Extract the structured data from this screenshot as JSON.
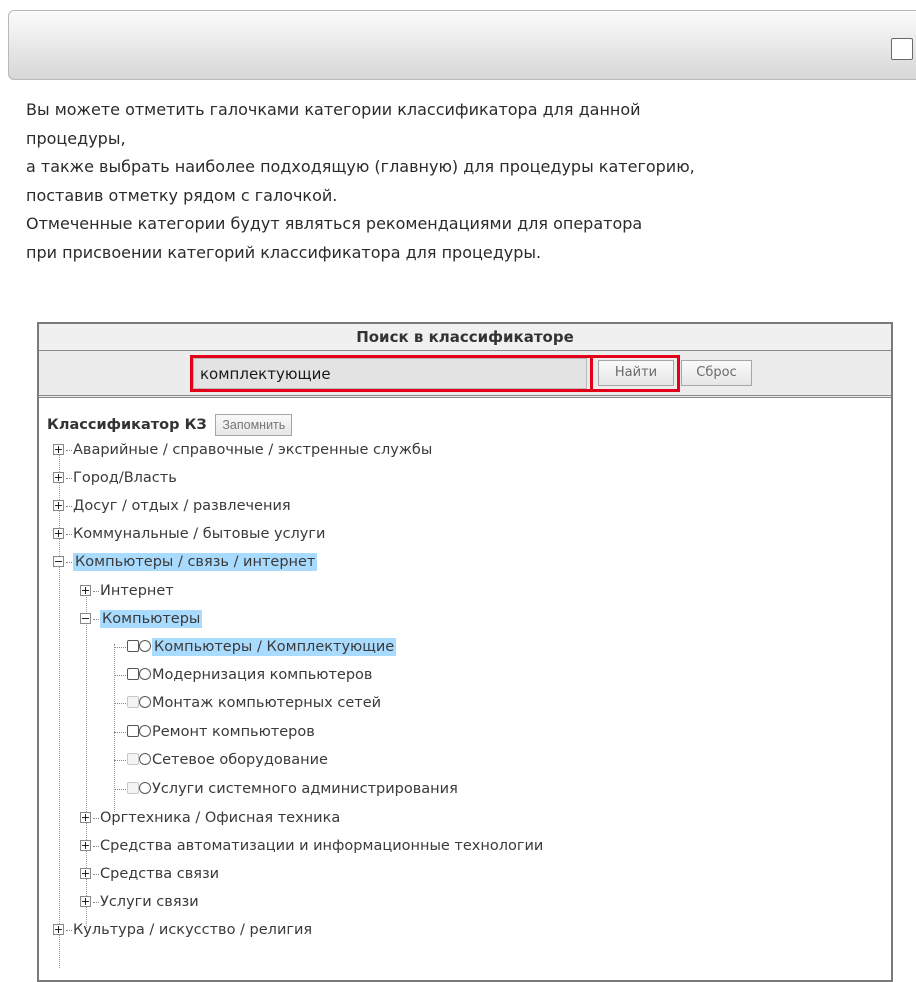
{
  "intro": {
    "line1": "Вы можете отметить галочками категории классификатора для данной",
    "line2": "процедуры,",
    "line3": "а также выбрать наиболее подходящую (главную) для процедуры категорию,",
    "line4": "поставив отметку рядом с галочкой.",
    "line5": "Отмеченные категории будут являться рекомендациями для оператора",
    "line6": "при присвоении категорий классификатора для процедуры."
  },
  "search": {
    "title": "Поиск в классификаторе",
    "value": "комплектующие",
    "find_label": "Найти",
    "reset_label": "Сброс"
  },
  "tree": {
    "title": "Классификатор КЗ",
    "remember_label": "Запомнить",
    "items": [
      {
        "label": "Аварийные / справочные / экстренные службы"
      },
      {
        "label": "Город/Власть"
      },
      {
        "label": "Досуг / отдых / развлечения"
      },
      {
        "label": "Коммунальные / бытовые услуги"
      },
      {
        "label": "Компьютеры / связь / интернет"
      },
      {
        "label": "Интернет"
      },
      {
        "label": "Компьютеры"
      },
      {
        "label": "Компьютеры / Комплектующие"
      },
      {
        "label": "Модернизация компьютеров"
      },
      {
        "label": "Монтаж компьютерных сетей"
      },
      {
        "label": "Ремонт компьютеров"
      },
      {
        "label": "Сетевое оборудование"
      },
      {
        "label": "Услуги системного администрирования"
      },
      {
        "label": "Оргтехника / Офисная техника"
      },
      {
        "label": "Средства автоматизации и информационные технологии"
      },
      {
        "label": "Средства связи"
      },
      {
        "label": "Услуги связи"
      },
      {
        "label": "Культура / искусство / религия"
      }
    ]
  },
  "colors": {
    "highlight_border": "#e2001a",
    "selected_background": "#a9dbff"
  }
}
